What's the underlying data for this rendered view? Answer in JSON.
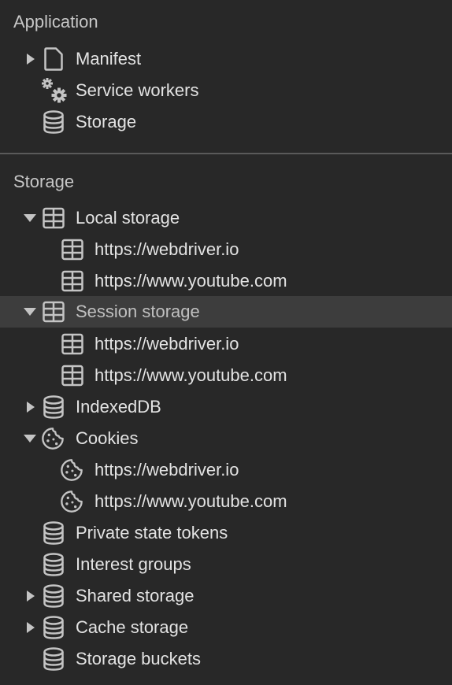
{
  "application": {
    "title": "Application",
    "items": [
      {
        "label": "Manifest",
        "icon": "file-icon",
        "expandable": true,
        "expanded": false
      },
      {
        "label": "Service workers",
        "icon": "gears-icon",
        "expandable": false
      },
      {
        "label": "Storage",
        "icon": "database-icon",
        "expandable": false
      }
    ]
  },
  "storage": {
    "title": "Storage",
    "items": [
      {
        "label": "Local storage",
        "icon": "table-icon",
        "expandable": true,
        "expanded": true,
        "children": [
          {
            "label": "https://webdriver.io",
            "icon": "table-icon"
          },
          {
            "label": "https://www.youtube.com",
            "icon": "table-icon"
          }
        ]
      },
      {
        "label": "Session storage",
        "icon": "table-icon",
        "expandable": true,
        "expanded": true,
        "selected": true,
        "children": [
          {
            "label": "https://webdriver.io",
            "icon": "table-icon"
          },
          {
            "label": "https://www.youtube.com",
            "icon": "table-icon"
          }
        ]
      },
      {
        "label": "IndexedDB",
        "icon": "database-icon",
        "expandable": true,
        "expanded": false
      },
      {
        "label": "Cookies",
        "icon": "cookie-icon",
        "expandable": true,
        "expanded": true,
        "children": [
          {
            "label": "https://webdriver.io",
            "icon": "cookie-icon"
          },
          {
            "label": "https://www.youtube.com",
            "icon": "cookie-icon"
          }
        ]
      },
      {
        "label": "Private state tokens",
        "icon": "database-icon",
        "expandable": false
      },
      {
        "label": "Interest groups",
        "icon": "database-icon",
        "expandable": false
      },
      {
        "label": "Shared storage",
        "icon": "database-icon",
        "expandable": true,
        "expanded": false
      },
      {
        "label": "Cache storage",
        "icon": "database-icon",
        "expandable": true,
        "expanded": false
      },
      {
        "label": "Storage buckets",
        "icon": "database-icon",
        "expandable": false
      }
    ]
  },
  "colors": {
    "background": "#282828",
    "selected_row": "#3d3d3d",
    "text": "#e3e3e3",
    "icon": "#c4c4c4",
    "divider": "#5a5a5a"
  }
}
